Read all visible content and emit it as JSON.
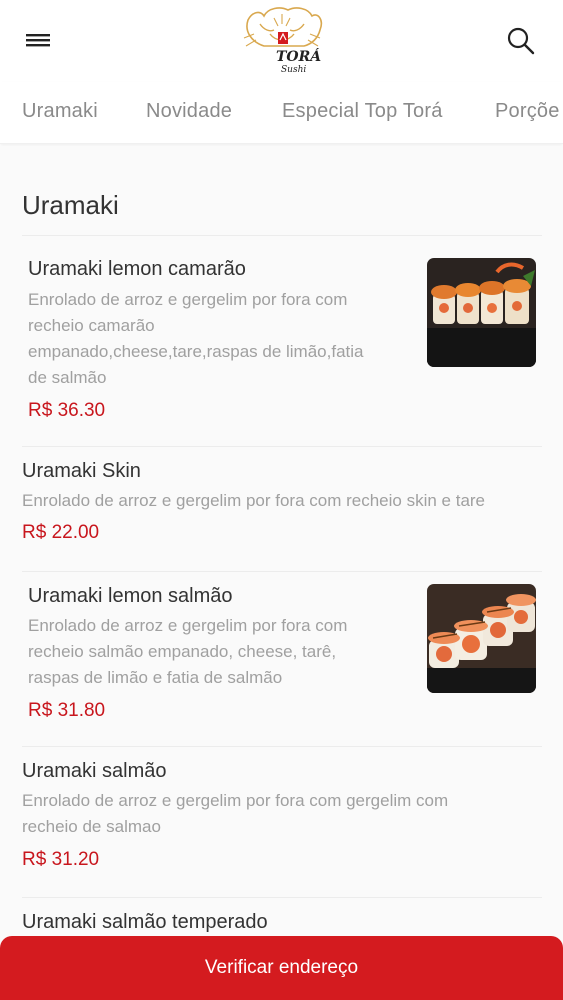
{
  "header": {
    "logo_text": "TORÁ",
    "logo_subtext": "Sushi"
  },
  "tabs": [
    {
      "label": "Uramaki"
    },
    {
      "label": "Novidade"
    },
    {
      "label": "Especial Top Torá"
    },
    {
      "label": "Porçõe"
    }
  ],
  "section": {
    "title": "Uramaki"
  },
  "items": [
    {
      "name": "Uramaki lemon camarão",
      "description": [
        "Enrolado de arroz e gergelim por fora com",
        "recheio camarão",
        "empanado,cheese,tare,raspas de limão,fatia",
        "de salmão"
      ],
      "price": "R$ 36.30",
      "image": "uramaki-lemon-camarao-photo"
    },
    {
      "name": "Uramaki Skin",
      "description": [
        "Enrolado de arroz e gergelim por fora com recheio skin e tare"
      ],
      "price": "R$ 22.00"
    },
    {
      "name": "Uramaki lemon salmão",
      "description": [
        "Enrolado de arroz e gergelim por fora com",
        "recheio salmão empanado, cheese, tarê,",
        "raspas de limão e fatia de salmão"
      ],
      "price": "R$ 31.80",
      "image": "uramaki-lemon-salmao-photo"
    },
    {
      "name": "Uramaki salmão",
      "description": [
        "Enrolado de arroz e gergelim por fora com gergelim com",
        "recheio de salmao"
      ],
      "price": "R$ 31.20"
    },
    {
      "name": "Uramaki salmão temperado"
    }
  ],
  "footer": {
    "cta_label": "Verificar endereço"
  },
  "colors": {
    "accent": "#d41b1f",
    "price": "#c8161d",
    "muted_text": "#a0a0a0"
  },
  "icons": [
    "menu-icon",
    "search-icon"
  ]
}
